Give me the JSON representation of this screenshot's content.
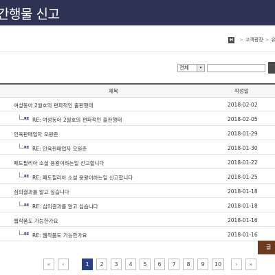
{
  "header": {
    "title": "간행물 신고"
  },
  "breadcrumb": {
    "home": "H",
    "items": [
      "고객광장",
      "유해"
    ]
  },
  "search": {
    "select_value": "전체",
    "input_value": ""
  },
  "table": {
    "columns": [
      "제목",
      "작성일"
    ],
    "reply_badge": "RE",
    "rows": [
      {
        "title": "여성동아 2월호의 편파적인 출판행태",
        "date": "2018-02-02",
        "reply": false
      },
      {
        "title": "RE: 여성동아 2월호의 편파적인 출판행태",
        "date": "2018-02-05",
        "reply": true
      },
      {
        "title": "인육판매업자 오원춘",
        "date": "2018-01-29",
        "reply": false
      },
      {
        "title": "RE: 인육판매업자 오원춘",
        "date": "2018-01-30",
        "reply": true
      },
      {
        "title": "페도필리아 소설 용왕이하는일 신고합니다",
        "date": "2018-01-22",
        "reply": false
      },
      {
        "title": "RE: 페도필리아 소설 용왕이하는일 신고합니다",
        "date": "2018-01-25",
        "reply": true
      },
      {
        "title": "심의결과를 알고 싶습니다",
        "date": "2018-01-18",
        "reply": false
      },
      {
        "title": "RE: 심의결과를 알고 싶습니다",
        "date": "2018-01-18",
        "reply": true
      },
      {
        "title": "웹작품도 가능한가요",
        "date": "2018-01-16",
        "reply": false
      },
      {
        "title": "RE: 웹작품도 가능한가요",
        "date": "2018-01-16",
        "reply": true
      }
    ]
  },
  "write_button": {
    "label": "글"
  },
  "pagination": {
    "first": "«",
    "prev": "‹",
    "pages": [
      "1",
      "2",
      "3",
      "4",
      "5",
      "6",
      "7",
      "8",
      "9",
      "10"
    ],
    "current": "1",
    "next": "›",
    "last": "»"
  }
}
